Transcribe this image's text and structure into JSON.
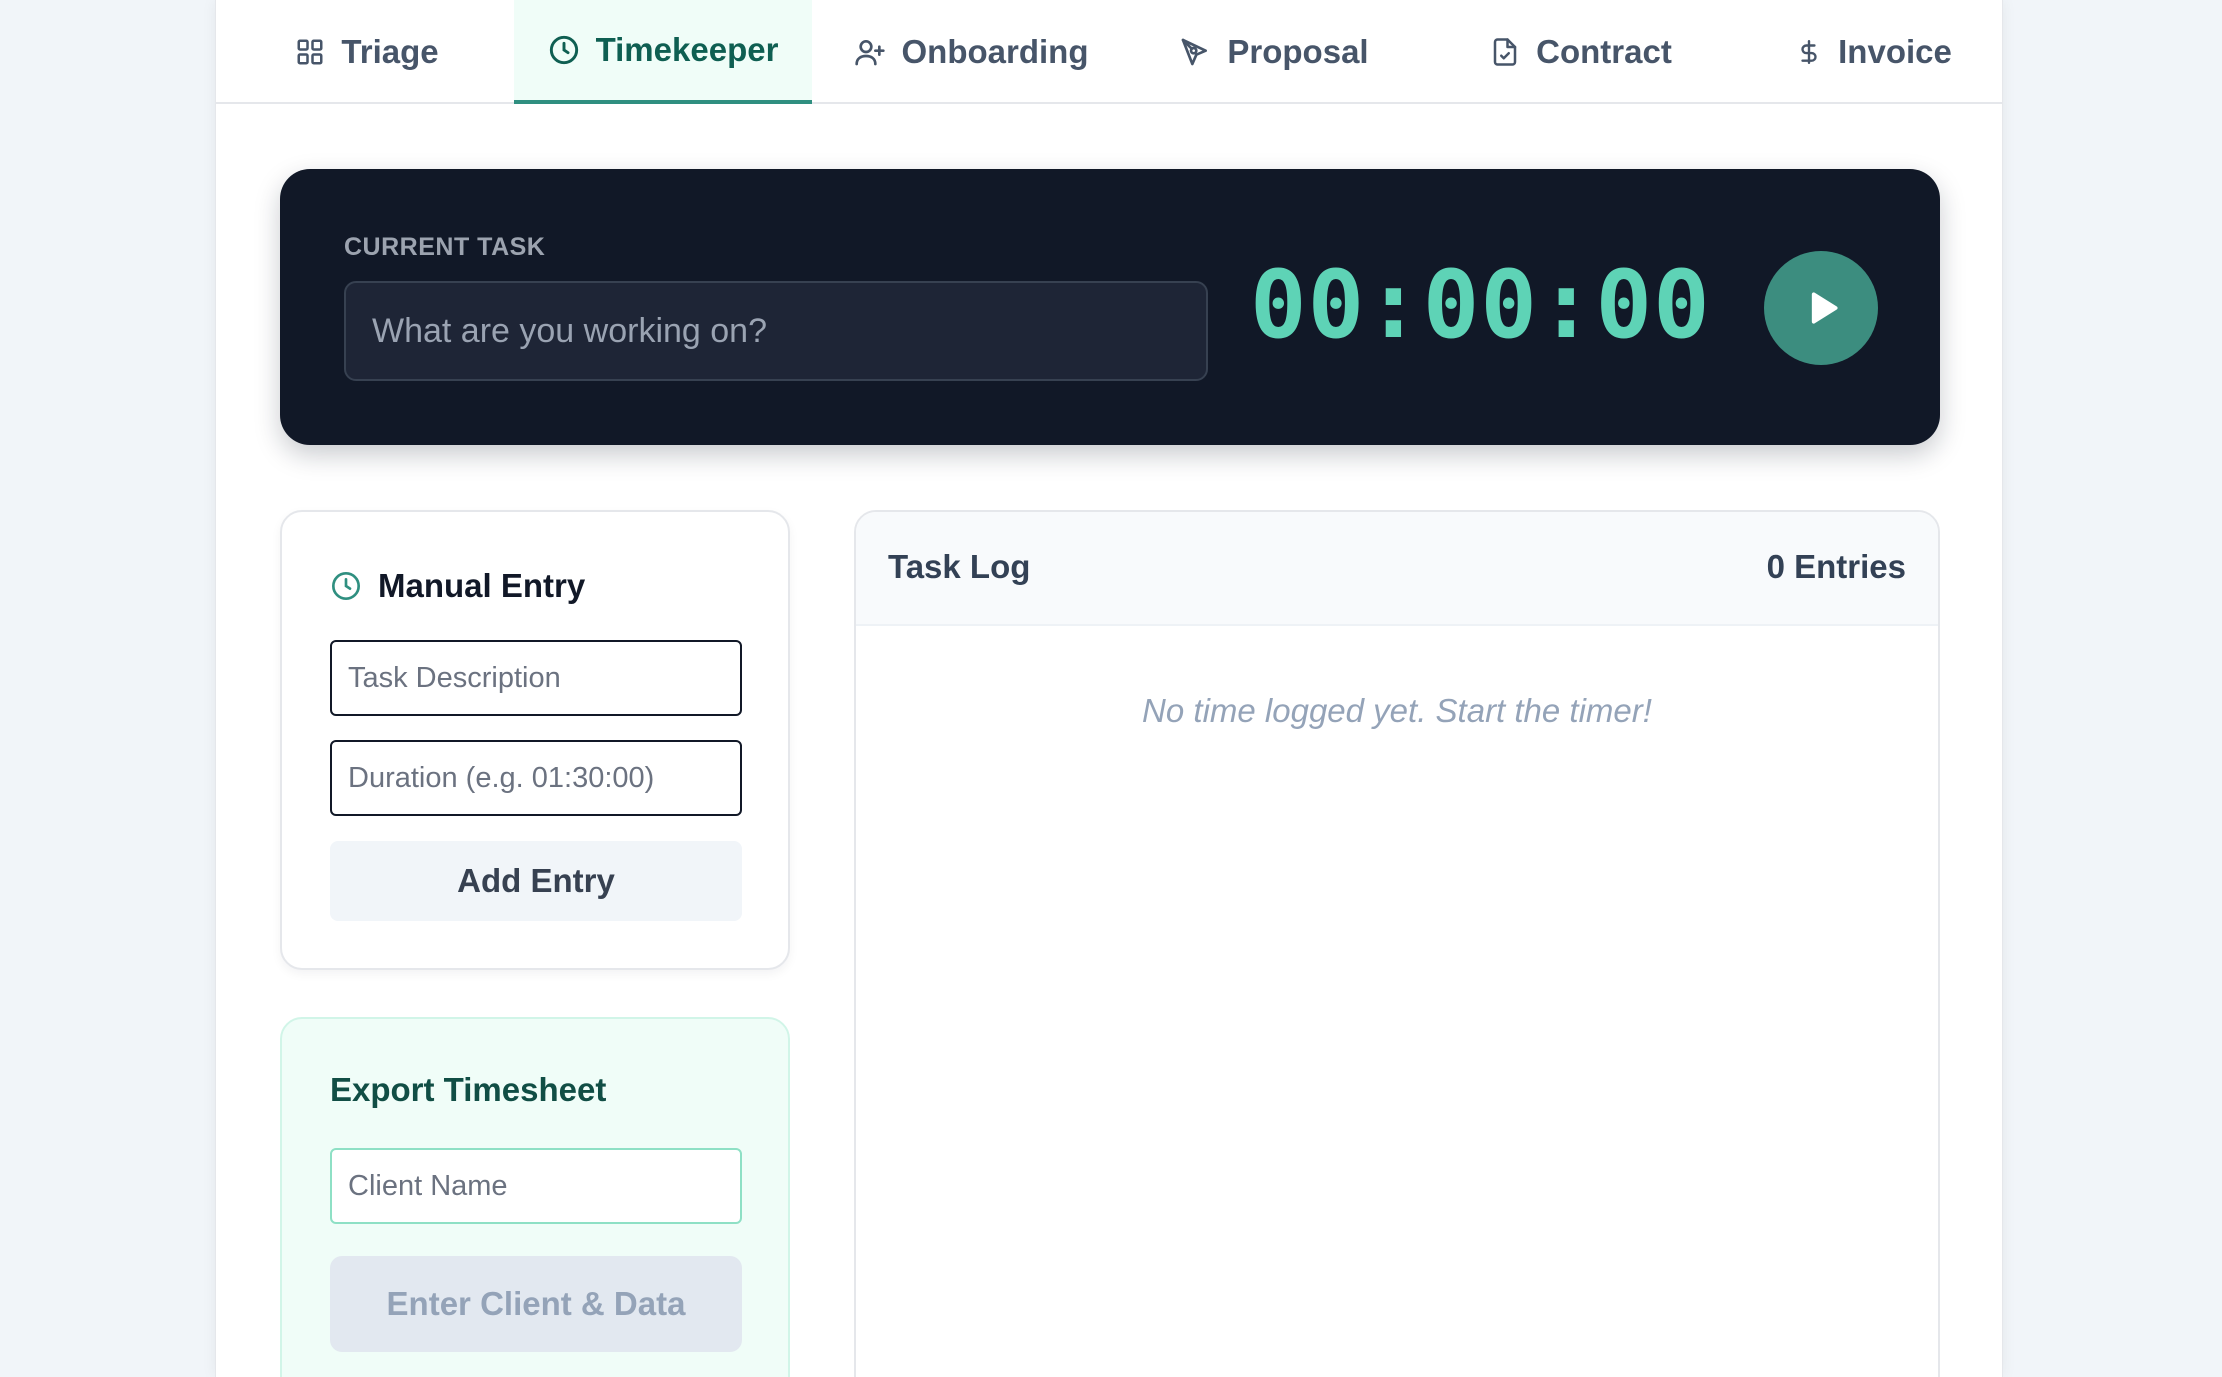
{
  "tabs": [
    {
      "label": "Triage",
      "icon": "grid-icon"
    },
    {
      "label": "Timekeeper",
      "icon": "clock-icon",
      "active": true
    },
    {
      "label": "Onboarding",
      "icon": "user-plus-icon"
    },
    {
      "label": "Proposal",
      "icon": "pen-tool-icon"
    },
    {
      "label": "Contract",
      "icon": "file-check-icon"
    },
    {
      "label": "Invoice",
      "icon": "dollar-icon"
    }
  ],
  "timer": {
    "label": "CURRENT TASK",
    "placeholder": "What are you working on?",
    "value": "",
    "clock": "00:00:00",
    "accent_color": "#5ed3b6"
  },
  "manual_entry": {
    "title": "Manual Entry",
    "task_placeholder": "Task Description",
    "duration_placeholder": "Duration (e.g. 01:30:00)",
    "add_label": "Add Entry"
  },
  "export": {
    "title": "Export Timesheet",
    "client_placeholder": "Client Name",
    "button_label": "Enter Client & Data"
  },
  "task_log": {
    "title": "Task Log",
    "count": "0 Entries",
    "empty_text": "No time logged yet. Start the timer!"
  }
}
